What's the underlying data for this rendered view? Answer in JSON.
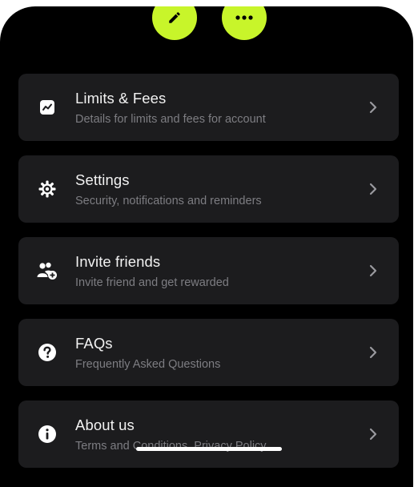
{
  "top_actions": {
    "edit_icon": "pencil-icon",
    "more_icon": "more-horizontal-icon",
    "accent_color": "#c8f52a"
  },
  "menu": {
    "items": [
      {
        "title": "Limits & Fees",
        "subtitle": "Details for limits and fees for account",
        "icon": "trend-chart-icon"
      },
      {
        "title": "Settings",
        "subtitle": "Security, notifications and reminders",
        "icon": "gear-icon"
      },
      {
        "title": "Invite friends",
        "subtitle": "Invite friend and get rewarded",
        "icon": "add-user-icon"
      },
      {
        "title": "FAQs",
        "subtitle": "Frequently Asked Questions",
        "icon": "question-icon"
      },
      {
        "title": "About us",
        "subtitle": "Terms and Conditions, Privacy Policy",
        "icon": "info-icon"
      }
    ]
  }
}
